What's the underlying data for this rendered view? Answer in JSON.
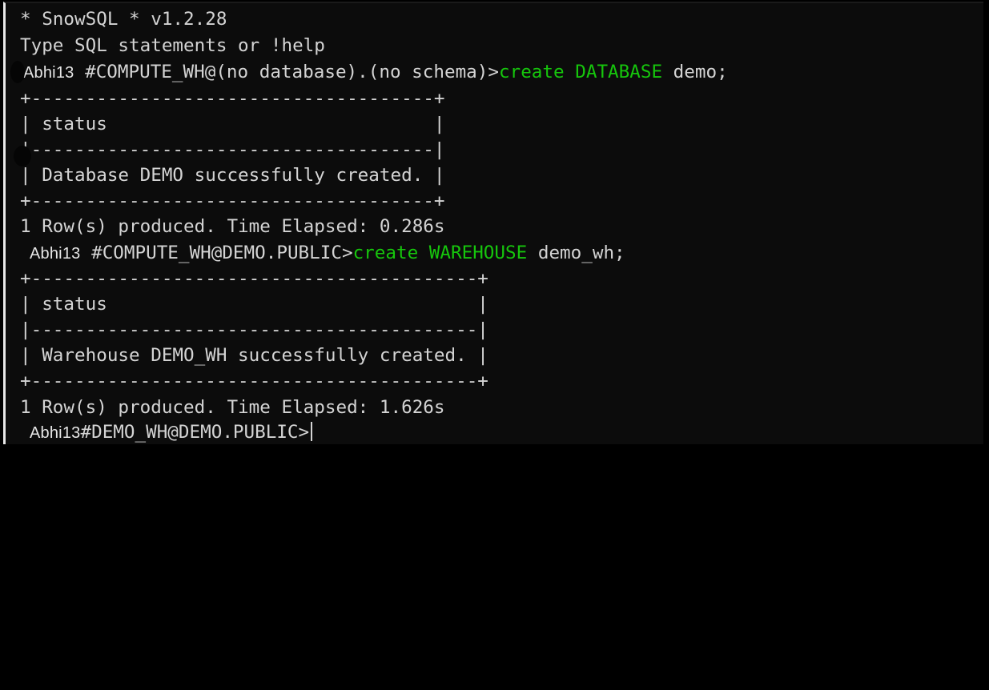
{
  "terminal": {
    "banner": "* SnowSQL * v1.2.28",
    "help_line": "Type SQL statements or !help",
    "session1": {
      "user": "Abhi13",
      "prompt": " #COMPUTE_WH@(no database).(no schema)>",
      "cmd_create": "create",
      "cmd_keyword": "DATABASE",
      "cmd_rest": " demo;",
      "border_top": "+-------------------------------------+",
      "header": "| status                              |",
      "separator": "|-------------------------------------|",
      "row": "| Database DEMO successfully created. |",
      "border_bottom": "+-------------------------------------+",
      "footer": "1 Row(s) produced. Time Elapsed: 0.286s"
    },
    "session2": {
      "user": "Abhi13",
      "prompt": "#COMPUTE_WH@DEMO.PUBLIC>",
      "cmd_create": "create",
      "cmd_keyword": "WAREHOUSE",
      "cmd_rest": " demo_wh;",
      "border_top": "+-----------------------------------------+",
      "header": "| status                                  |",
      "separator": "|-----------------------------------------|",
      "row": "| Warehouse DEMO_WH successfully created. |",
      "border_bottom": "+-----------------------------------------+",
      "footer": "1 Row(s) produced. Time Elapsed: 1.626s"
    },
    "session3": {
      "user": "Abhi13",
      "prompt": "#DEMO_WH@DEMO.PUBLIC>"
    }
  },
  "colors": {
    "background": "#0c0c0c",
    "text": "#d4d4d4",
    "command_green": "#16c60c"
  }
}
